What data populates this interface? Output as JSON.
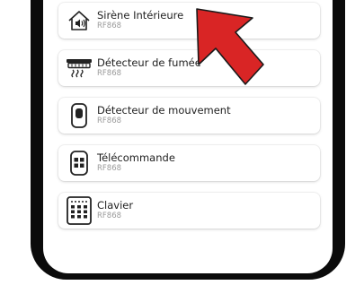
{
  "devices": [
    {
      "name": "Sirène Intérieure",
      "model": "RF868",
      "icon": "siren-icon"
    },
    {
      "name": "Détecteur de fumée",
      "model": "RF868",
      "icon": "smoke-detector-icon"
    },
    {
      "name": "Détecteur de mouvement",
      "model": "RF868",
      "icon": "motion-detector-icon"
    },
    {
      "name": "Télécommande",
      "model": "RF868",
      "icon": "remote-control-icon"
    },
    {
      "name": "Clavier",
      "model": "RF868",
      "icon": "keypad-icon"
    }
  ],
  "annotation": {
    "arrow_color": "#d92525",
    "arrow_icon": "arrow-icon"
  }
}
